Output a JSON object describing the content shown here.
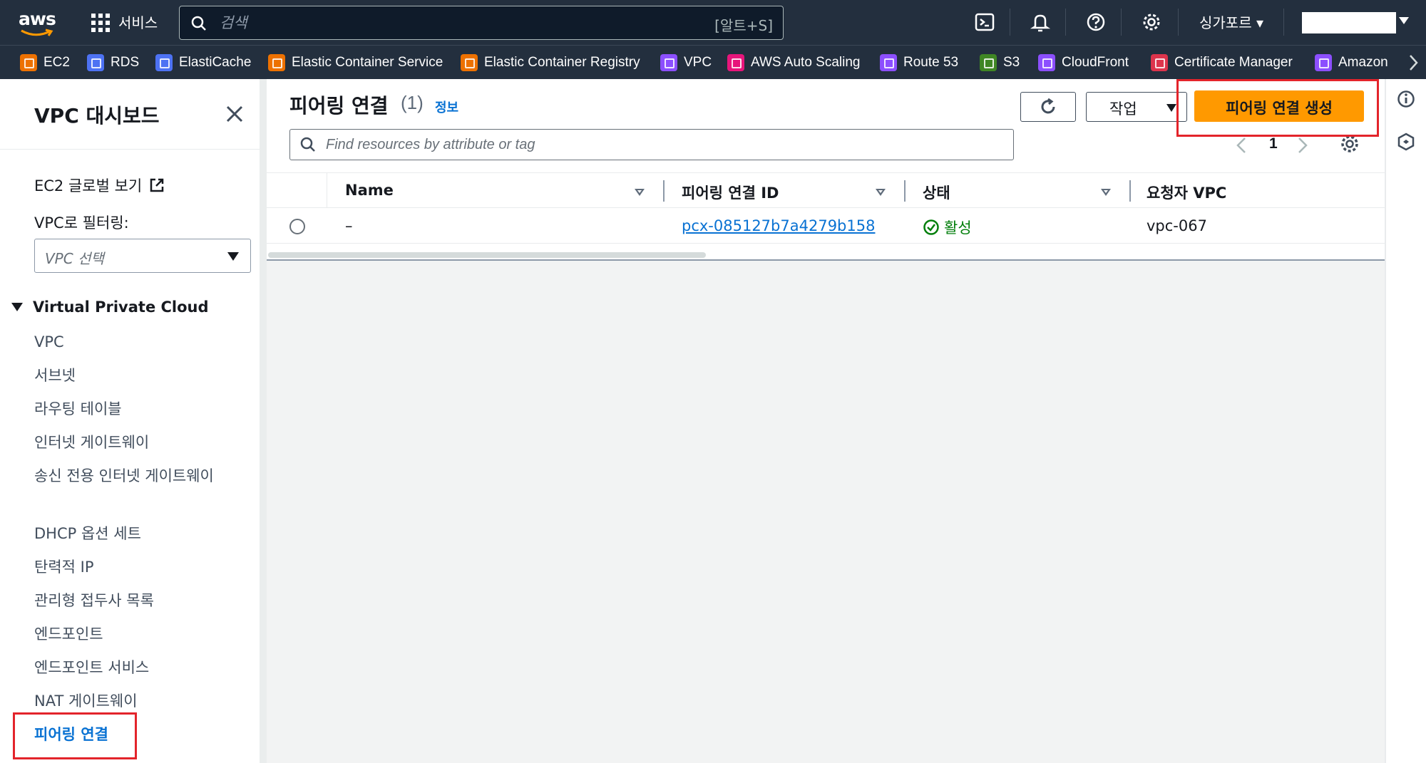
{
  "topnav": {
    "logo_text": "aws",
    "services_label": "서비스",
    "search_placeholder": "검색",
    "search_shortcut": "[알트+S]",
    "region_label": "싱가포르 ▾"
  },
  "favorites": [
    {
      "label": "EC2",
      "color": "#ed7100"
    },
    {
      "label": "RDS",
      "color": "#4d72f3"
    },
    {
      "label": "ElastiCache",
      "color": "#4d72f3"
    },
    {
      "label": "Elastic Container Service",
      "color": "#ed7100"
    },
    {
      "label": "Elastic Container Registry",
      "color": "#ed7100"
    },
    {
      "label": "VPC",
      "color": "#8c4fff"
    },
    {
      "label": "AWS Auto Scaling",
      "color": "#e7157b"
    },
    {
      "label": "Route 53",
      "color": "#8c4fff"
    },
    {
      "label": "S3",
      "color": "#3f8624"
    },
    {
      "label": "CloudFront",
      "color": "#8c4fff"
    },
    {
      "label": "Certificate Manager",
      "color": "#dd344c"
    },
    {
      "label": "Amazon C",
      "color": "#8c4fff"
    }
  ],
  "sidebar": {
    "title": "VPC 대시보드",
    "ec2_global_view": "EC2 글로벌 보기",
    "filter_label": "VPC로 필터링:",
    "vpc_select_placeholder": "VPC 선택",
    "section": "Virtual Private Cloud",
    "items": [
      {
        "label": "VPC"
      },
      {
        "label": "서브넷"
      },
      {
        "label": "라우팅 테이블"
      },
      {
        "label": "인터넷 게이트웨이"
      },
      {
        "label": "송신 전용 인터넷 게이트웨이"
      },
      {
        "label": "DHCP 옵션 세트"
      },
      {
        "label": "탄력적 IP"
      },
      {
        "label": "관리형 접두사 목록"
      },
      {
        "label": "엔드포인트"
      },
      {
        "label": "엔드포인트 서비스"
      },
      {
        "label": "NAT 게이트웨이"
      },
      {
        "label": "피어링 연결"
      }
    ],
    "active_item": "피어링 연결"
  },
  "main": {
    "title": "피어링 연결",
    "count": "(1)",
    "info_link": "정보",
    "actions_label": "작업",
    "create_label": "피어링 연결 생성",
    "filter_placeholder": "Find resources by attribute or tag",
    "page_number": "1",
    "columns": [
      "Name",
      "피어링 연결 ID",
      "상태",
      "요청자 VPC"
    ],
    "rows": [
      {
        "name": "–",
        "id": "pcx-085127b7a4279b158",
        "status": "활성",
        "requester_vpc": "vpc-067"
      }
    ]
  },
  "colors": {
    "nav_bg": "#232f3e",
    "primary_button": "#ff9900",
    "link": "#0972d3",
    "status_active": "#037f0c",
    "highlight": "#e3242b"
  }
}
